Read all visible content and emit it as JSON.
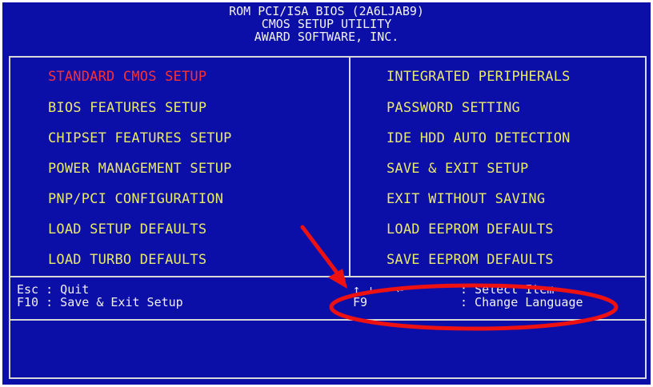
{
  "header": {
    "line1": "ROM PCI/ISA BIOS (2A6LJAB9)",
    "line2": "CMOS SETUP UTILITY",
    "line3": "AWARD SOFTWARE, INC."
  },
  "menu": {
    "left": [
      "STANDARD CMOS SETUP",
      "BIOS FEATURES SETUP",
      "CHIPSET FEATURES SETUP",
      "POWER MANAGEMENT SETUP",
      "PNP/PCI CONFIGURATION",
      "LOAD SETUP DEFAULTS",
      "LOAD TURBO DEFAULTS"
    ],
    "right": [
      "INTEGRATED PERIPHERALS",
      "PASSWORD SETTING",
      "IDE HDD AUTO DETECTION",
      "SAVE & EXIT SETUP",
      "EXIT WITHOUT SAVING",
      "LOAD EEPROM DEFAULTS",
      "SAVE EEPROM DEFAULTS"
    ],
    "selected_left_index": 0
  },
  "help": {
    "esc_key": "Esc : Quit",
    "f10_key": "F10 : Save & Exit Setup",
    "arrows_key": "↑ ↓ → ←",
    "select_item": ": Select Item",
    "f9_key": "F9",
    "change_language": ": Change Language"
  },
  "colors": {
    "background": "#0b0fa8",
    "menu_text": "#e8e86a",
    "selected_text": "#ff3030",
    "border": "#d8d8d8",
    "annotation": "#ee1111"
  }
}
